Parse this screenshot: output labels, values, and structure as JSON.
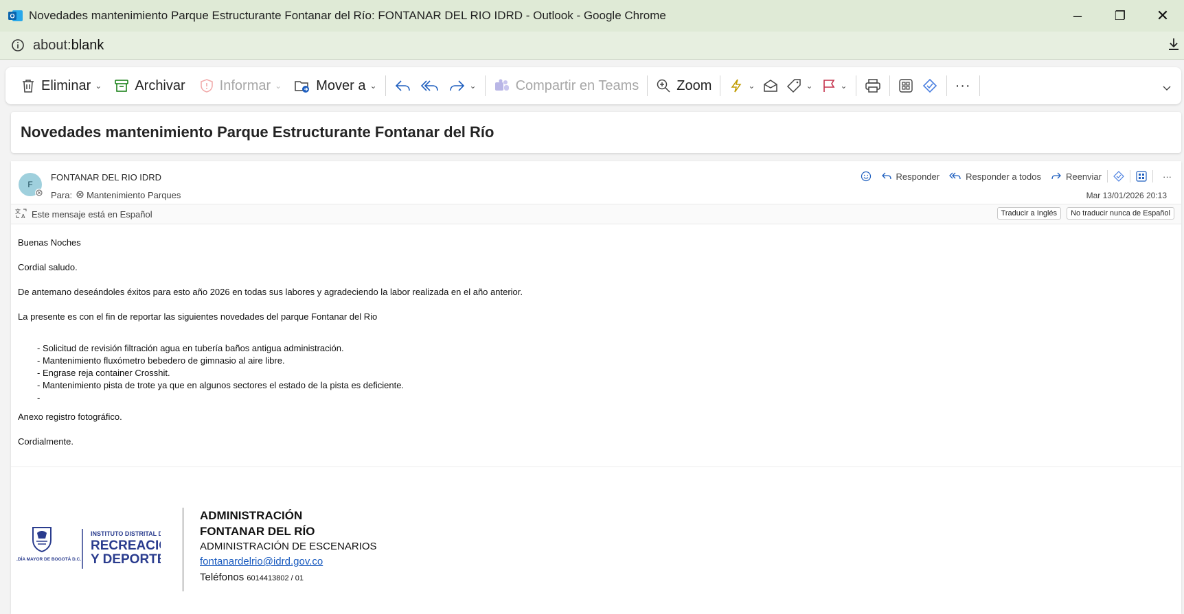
{
  "window": {
    "title": "Novedades mantenimiento Parque Estructurante Fontanar del Río: FONTANAR DEL RIO IDRD - Outlook - Google Chrome",
    "url_scheme": "about:",
    "url_path": "blank",
    "controls": {
      "minimize": "–",
      "restore": "❐",
      "close": "✕"
    }
  },
  "ribbon": {
    "eliminar": "Eliminar",
    "archivar": "Archivar",
    "informar": "Informar",
    "mover": "Mover a",
    "compartir": "Compartir en Teams",
    "zoom": "Zoom",
    "more": "···"
  },
  "message": {
    "subject": "Novedades mantenimiento Parque Estructurante Fontanar del Río",
    "avatar_initial": "F",
    "sender": "FONTANAR DEL RIO IDRD",
    "to_label": "Para:",
    "to_value": "Mantenimiento Parques",
    "date": "Mar 13/01/2026 20:13",
    "actions": {
      "responder": "Responder",
      "responder_todos": "Responder a todos",
      "reenviar": "Reenviar",
      "more": "···"
    },
    "translation": {
      "notice": "Este mensaje está en Español",
      "translate_btn": "Traducir a Inglés",
      "never_btn": "No traducir nunca de Español"
    },
    "body": {
      "greeting": "Buenas Noches",
      "salute": "Cordial saludo.",
      "p1": "De antemano deseándoles éxitos para esto año 2026 en todas sus labores y agradeciendo la labor realizada en el año anterior.",
      "p2": "La presente es con el fin de reportar las siguientes novedades del parque Fontanar del Rio",
      "items": [
        "- Solicitud de revisión filtración agua en tubería baños antigua administración.",
        "- Mantenimiento fluxómetro bebedero de gimnasio al aire libre.",
        "- Engrase reja container Crosshit.",
        "- Mantenimiento pista de trote ya que en algunos sectores el estado de la pista es deficiente.",
        "-"
      ],
      "annex": "Anexo registro fotográfico.",
      "closing": "Cordialmente."
    },
    "signature": {
      "logo_alcaldia": "ALCALDÍA MAYOR DE BOGOTÁ D.C.",
      "logo_inst": "INSTITUTO DISTRITAL DE",
      "logo_rec": "RECREACIÓN",
      "logo_dep": "Y DEPORTE",
      "line1": "ADMINISTRACIÓN",
      "line2": "FONTANAR DEL RÍO",
      "line3": "ADMINISTRACIÓN DE ESCENARIOS",
      "email": "fontanardelrio@idrd.gov.co",
      "phone_label": "Teléfonos",
      "phone_value": "6014413802 / 01"
    }
  },
  "colors": {
    "title_bar": "#dfead6",
    "reply_accent": "#1f5fbf",
    "flag": "#c4314b",
    "lightning": "#c19c00",
    "logo_blue": "#2a3c8e"
  }
}
